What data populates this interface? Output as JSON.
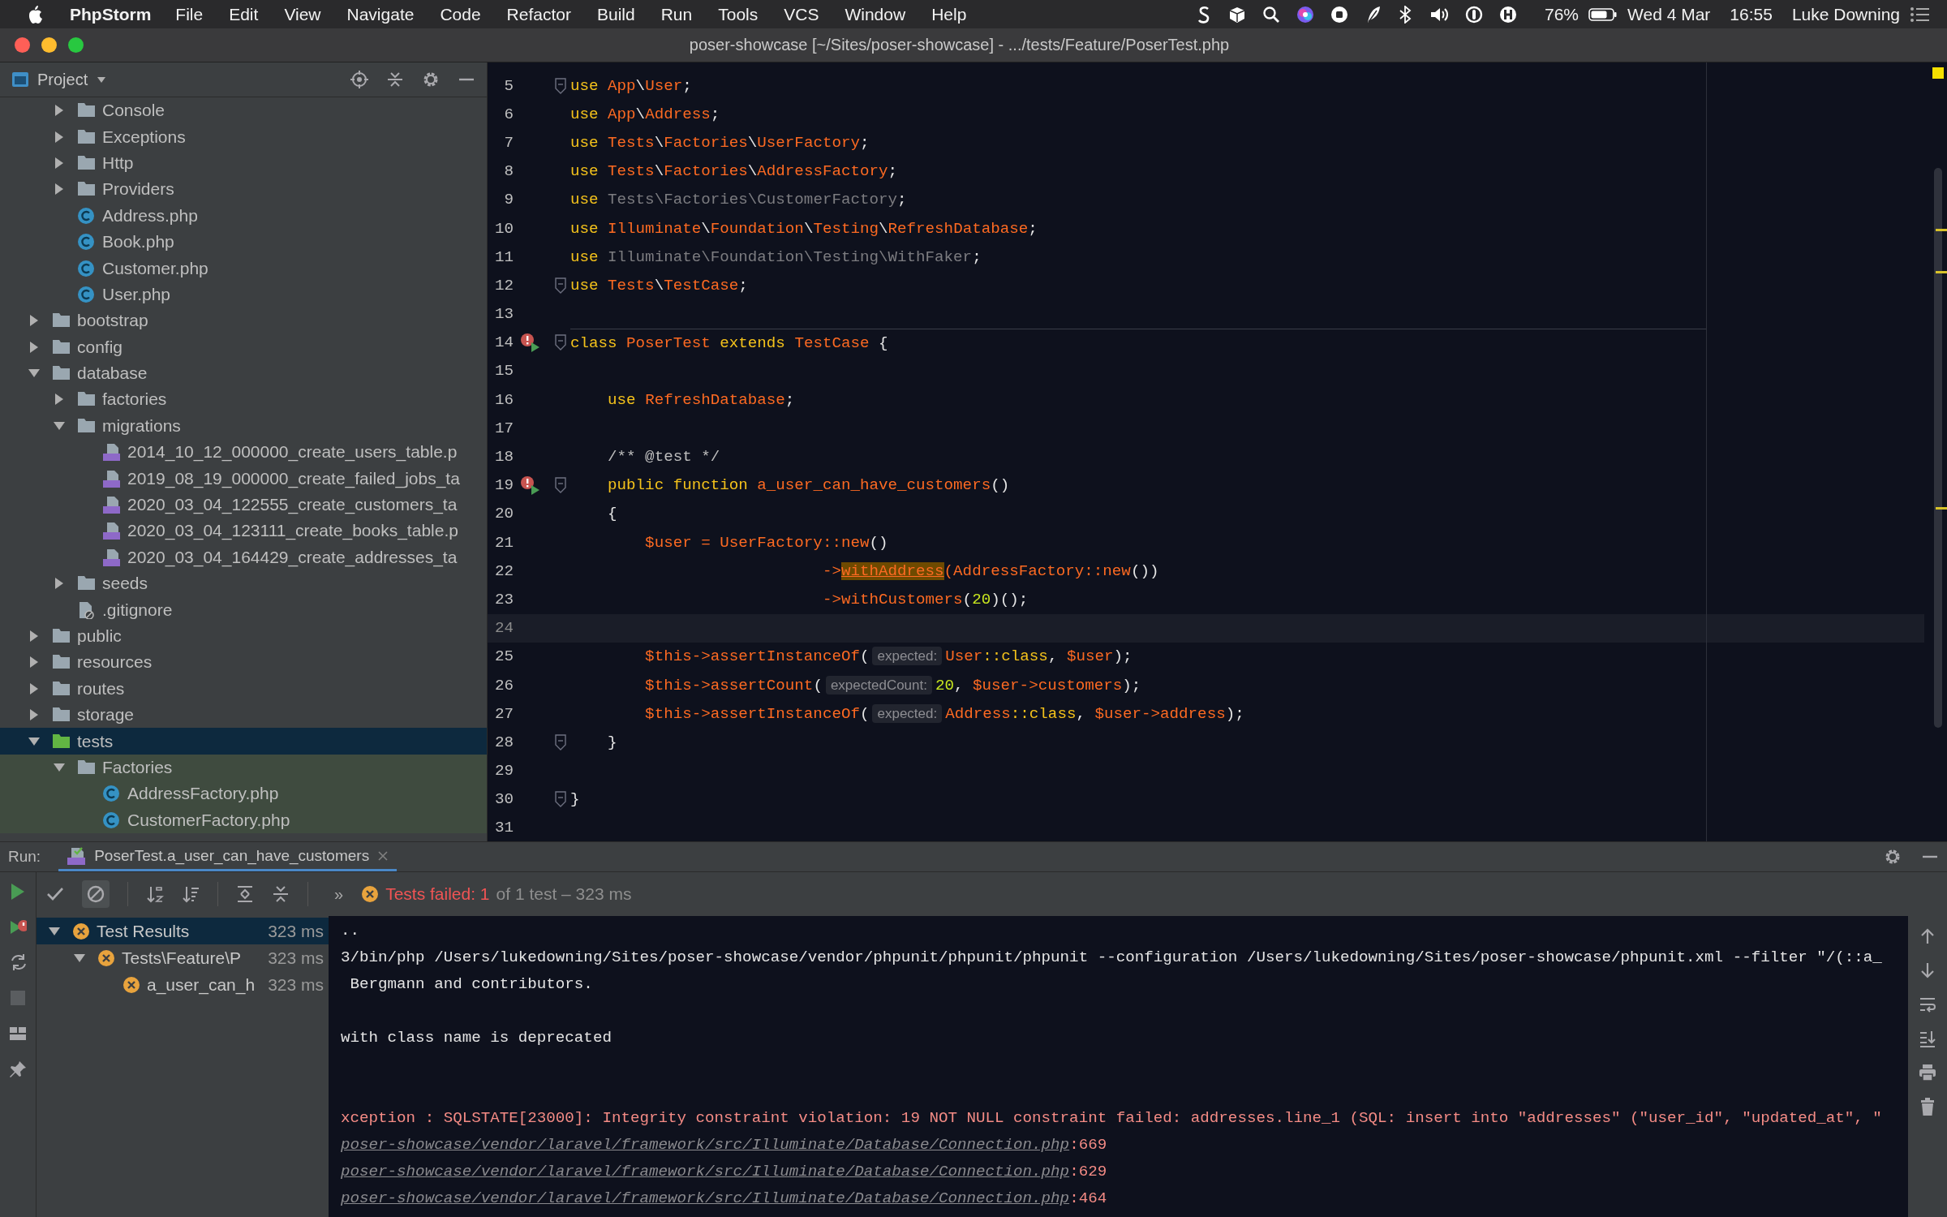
{
  "menu_bar": {
    "app": "PhpStorm",
    "menus": [
      "File",
      "Edit",
      "View",
      "Navigate",
      "Code",
      "Refactor",
      "Build",
      "Run",
      "Tools",
      "VCS",
      "Window",
      "Help"
    ],
    "battery": "76%",
    "date": "Wed 4 Mar",
    "time": "16:55",
    "user": "Luke Downing"
  },
  "window": {
    "title": "poser-showcase [~/Sites/poser-showcase] - .../tests/Feature/PoserTest.php"
  },
  "project_panel": {
    "title": "Project",
    "tree": {
      "continued": [
        {
          "label": "Console",
          "kind": "folder",
          "expanded": false,
          "selected": false
        },
        {
          "label": "Exceptions",
          "kind": "folder",
          "expanded": false,
          "selected": false
        },
        {
          "label": "Http",
          "kind": "folder",
          "expanded": false,
          "selected": false
        },
        {
          "label": "Providers",
          "kind": "folder",
          "expanded": false,
          "selected": false
        },
        {
          "label": "Address.php",
          "kind": "class",
          "selected": false
        },
        {
          "label": "Book.php",
          "kind": "class",
          "selected": false
        },
        {
          "label": "Customer.php",
          "kind": "class",
          "selected": false
        },
        {
          "label": "User.php",
          "kind": "class",
          "selected": false
        }
      ],
      "items": [
        {
          "label": "bootstrap",
          "kind": "folder",
          "expanded": false,
          "selected": false
        },
        {
          "label": "config",
          "kind": "folder",
          "expanded": false,
          "selected": false
        },
        {
          "label": "database",
          "kind": "folder",
          "expanded": true,
          "selected": false,
          "children": [
            {
              "label": "factories",
              "kind": "folder",
              "expanded": false,
              "selected": false
            },
            {
              "label": "migrations",
              "kind": "folder",
              "expanded": true,
              "selected": false,
              "children": [
                {
                  "label": "2014_10_12_000000_create_users_table.p",
                  "kind": "php",
                  "selected": false
                },
                {
                  "label": "2019_08_19_000000_create_failed_jobs_ta",
                  "kind": "php",
                  "selected": false
                },
                {
                  "label": "2020_03_04_122555_create_customers_ta",
                  "kind": "php",
                  "selected": false
                },
                {
                  "label": "2020_03_04_123111_create_books_table.p",
                  "kind": "php",
                  "selected": false
                },
                {
                  "label": "2020_03_04_164429_create_addresses_ta",
                  "kind": "php",
                  "selected": false
                }
              ]
            },
            {
              "label": "seeds",
              "kind": "folder",
              "expanded": false,
              "selected": false
            },
            {
              "label": ".gitignore",
              "kind": "ignore",
              "selected": false
            }
          ]
        },
        {
          "label": "public",
          "kind": "folder",
          "expanded": false,
          "selected": false
        },
        {
          "label": "resources",
          "kind": "folder",
          "expanded": false,
          "selected": false
        },
        {
          "label": "routes",
          "kind": "folder",
          "expanded": false,
          "selected": false
        },
        {
          "label": "storage",
          "kind": "folder",
          "expanded": false,
          "selected": false
        },
        {
          "label": "tests",
          "kind": "test-folder",
          "expanded": true,
          "selected": true,
          "children": [
            {
              "label": "Factories",
              "kind": "folder",
              "expanded": true,
              "selected": false,
              "children": [
                {
                  "label": "AddressFactory.php",
                  "kind": "class",
                  "selected": false
                },
                {
                  "label": "CustomerFactory.php",
                  "kind": "class",
                  "selected": false
                }
              ]
            }
          ]
        }
      ]
    }
  },
  "editor": {
    "lines": [
      {
        "number": "5",
        "fold": true,
        "marker": false,
        "current": false,
        "separator": false,
        "tokens": [
          {
            "kind": "keyword",
            "text": "use "
          },
          {
            "kind": "name",
            "text": "App"
          },
          {
            "kind": "plain",
            "text": "\\"
          },
          {
            "kind": "name",
            "text": "User"
          },
          {
            "kind": "plain",
            "text": ";"
          }
        ]
      },
      {
        "number": "6",
        "fold": false,
        "marker": false,
        "current": false,
        "separator": false,
        "tokens": [
          {
            "kind": "keyword",
            "text": "use "
          },
          {
            "kind": "name",
            "text": "App"
          },
          {
            "kind": "plain",
            "text": "\\"
          },
          {
            "kind": "name",
            "text": "Address"
          },
          {
            "kind": "plain",
            "text": ";"
          }
        ]
      },
      {
        "number": "7",
        "fold": false,
        "marker": false,
        "current": false,
        "separator": false,
        "tokens": [
          {
            "kind": "keyword",
            "text": "use "
          },
          {
            "kind": "name",
            "text": "Tests"
          },
          {
            "kind": "plain",
            "text": "\\"
          },
          {
            "kind": "name",
            "text": "Factories"
          },
          {
            "kind": "plain",
            "text": "\\"
          },
          {
            "kind": "name",
            "text": "UserFactory"
          },
          {
            "kind": "plain",
            "text": ";"
          }
        ]
      },
      {
        "number": "8",
        "fold": false,
        "marker": false,
        "current": false,
        "separator": false,
        "tokens": [
          {
            "kind": "keyword",
            "text": "use "
          },
          {
            "kind": "name",
            "text": "Tests"
          },
          {
            "kind": "plain",
            "text": "\\"
          },
          {
            "kind": "name",
            "text": "Factories"
          },
          {
            "kind": "plain",
            "text": "\\"
          },
          {
            "kind": "name",
            "text": "AddressFactory"
          },
          {
            "kind": "plain",
            "text": ";"
          }
        ]
      },
      {
        "number": "9",
        "fold": false,
        "marker": false,
        "current": false,
        "separator": false,
        "tokens": [
          {
            "kind": "keyword",
            "text": "use "
          },
          {
            "kind": "dim",
            "text": "Tests\\Factories\\CustomerFactory"
          },
          {
            "kind": "plain",
            "text": ";"
          }
        ]
      },
      {
        "number": "10",
        "fold": false,
        "marker": false,
        "current": false,
        "separator": false,
        "tokens": [
          {
            "kind": "keyword",
            "text": "use "
          },
          {
            "kind": "name",
            "text": "Illuminate"
          },
          {
            "kind": "plain",
            "text": "\\"
          },
          {
            "kind": "name",
            "text": "Foundation"
          },
          {
            "kind": "plain",
            "text": "\\"
          },
          {
            "kind": "name",
            "text": "Testing"
          },
          {
            "kind": "plain",
            "text": "\\"
          },
          {
            "kind": "name",
            "text": "RefreshDatabase"
          },
          {
            "kind": "plain",
            "text": ";"
          }
        ]
      },
      {
        "number": "11",
        "fold": false,
        "marker": false,
        "current": false,
        "separator": false,
        "tokens": [
          {
            "kind": "keyword",
            "text": "use "
          },
          {
            "kind": "dim",
            "text": "Illuminate\\Foundation\\Testing\\WithFaker"
          },
          {
            "kind": "plain",
            "text": ";"
          }
        ]
      },
      {
        "number": "12",
        "fold": true,
        "marker": false,
        "current": false,
        "separator": false,
        "tokens": [
          {
            "kind": "keyword",
            "text": "use "
          },
          {
            "kind": "name",
            "text": "Tests"
          },
          {
            "kind": "plain",
            "text": "\\"
          },
          {
            "kind": "name",
            "text": "TestCase"
          },
          {
            "kind": "plain",
            "text": ";"
          }
        ]
      },
      {
        "number": "13",
        "fold": false,
        "marker": false,
        "current": false,
        "separator": false
      },
      {
        "number": "14",
        "fold": true,
        "marker": true,
        "current": false,
        "separator": true,
        "tokens": [
          {
            "kind": "keyword",
            "text": "class "
          },
          {
            "kind": "name",
            "text": "PoserTest"
          },
          {
            "kind": "keyword",
            "text": " extends "
          },
          {
            "kind": "name",
            "text": "TestCase"
          },
          {
            "kind": "plain",
            "text": " {"
          }
        ]
      },
      {
        "number": "15",
        "fold": false,
        "marker": false,
        "current": false,
        "separator": false
      },
      {
        "number": "16",
        "fold": false,
        "marker": false,
        "current": false,
        "separator": false,
        "tokens": [
          {
            "kind": "keyword",
            "text": "    use "
          },
          {
            "kind": "name",
            "text": "RefreshDatabase"
          },
          {
            "kind": "plain",
            "text": ";"
          }
        ]
      },
      {
        "number": "17",
        "fold": false,
        "marker": false,
        "current": false,
        "separator": false
      },
      {
        "number": "18",
        "fold": false,
        "marker": false,
        "current": false,
        "separator": false,
        "tokens": [
          {
            "kind": "comment",
            "text": "    /** @test */"
          }
        ]
      },
      {
        "number": "19",
        "fold": true,
        "marker": true,
        "current": false,
        "separator": false,
        "tokens": [
          {
            "kind": "keyword",
            "text": "    public function "
          },
          {
            "kind": "name",
            "text": "a_user_can_have_customers"
          },
          {
            "kind": "plain",
            "text": "()"
          }
        ]
      },
      {
        "number": "20",
        "fold": false,
        "marker": false,
        "current": false,
        "separator": false,
        "tokens": [
          {
            "kind": "plain",
            "text": "    {"
          }
        ]
      },
      {
        "number": "21",
        "fold": false,
        "marker": false,
        "current": false,
        "separator": false,
        "tokens": [
          {
            "kind": "name",
            "text": "        $user = UserFactory::new"
          },
          {
            "kind": "plain",
            "text": "()"
          }
        ]
      },
      {
        "number": "22",
        "fold": false,
        "marker": false,
        "current": false,
        "separator": false,
        "tokens": [
          {
            "kind": "name",
            "text": "                           ->"
          },
          {
            "kind": "highlight",
            "text": "withAddress"
          },
          {
            "kind": "name",
            "text": "(AddressFactory::new"
          },
          {
            "kind": "plain",
            "text": "())"
          }
        ]
      },
      {
        "number": "23",
        "fold": false,
        "marker": false,
        "current": false,
        "separator": false,
        "tokens": [
          {
            "kind": "name",
            "text": "                           ->withCustomers"
          },
          {
            "kind": "plain",
            "text": "("
          },
          {
            "kind": "number",
            "text": "20"
          },
          {
            "kind": "plain",
            "text": ")();"
          }
        ]
      },
      {
        "number": "24",
        "fold": false,
        "marker": false,
        "current": true,
        "separator": false
      },
      {
        "number": "25",
        "fold": false,
        "marker": false,
        "current": false,
        "separator": false,
        "tokens": [
          {
            "kind": "name",
            "text": "        $this->assertInstanceOf"
          },
          {
            "kind": "plain",
            "text": "("
          },
          {
            "kind": "hint",
            "text": "expected:"
          },
          {
            "kind": "name",
            "text": "User"
          },
          {
            "kind": "keyword",
            "text": "::class"
          },
          {
            "kind": "plain",
            "text": ", "
          },
          {
            "kind": "name",
            "text": "$user"
          },
          {
            "kind": "plain",
            "text": ");"
          }
        ]
      },
      {
        "number": "26",
        "fold": false,
        "marker": false,
        "current": false,
        "separator": false,
        "tokens": [
          {
            "kind": "name",
            "text": "        $this->assertCount"
          },
          {
            "kind": "plain",
            "text": "("
          },
          {
            "kind": "hint",
            "text": "expectedCount:"
          },
          {
            "kind": "number",
            "text": "20"
          },
          {
            "kind": "plain",
            "text": ", "
          },
          {
            "kind": "name",
            "text": "$user->customers"
          },
          {
            "kind": "plain",
            "text": ");"
          }
        ]
      },
      {
        "number": "27",
        "fold": false,
        "marker": false,
        "current": false,
        "separator": false,
        "tokens": [
          {
            "kind": "name",
            "text": "        $this->assertInstanceOf"
          },
          {
            "kind": "plain",
            "text": "("
          },
          {
            "kind": "hint",
            "text": "expected:"
          },
          {
            "kind": "name",
            "text": "Address"
          },
          {
            "kind": "keyword",
            "text": "::class"
          },
          {
            "kind": "plain",
            "text": ", "
          },
          {
            "kind": "name",
            "text": "$user->address"
          },
          {
            "kind": "plain",
            "text": ");"
          }
        ]
      },
      {
        "number": "28",
        "fold": true,
        "marker": false,
        "current": false,
        "separator": false,
        "tokens": [
          {
            "kind": "plain",
            "text": "    }"
          }
        ]
      },
      {
        "number": "29",
        "fold": false,
        "marker": false,
        "current": false,
        "separator": false
      },
      {
        "number": "30",
        "fold": true,
        "marker": false,
        "current": false,
        "separator": false,
        "tokens": [
          {
            "kind": "plain",
            "text": "}"
          }
        ]
      },
      {
        "number": "31",
        "fold": false,
        "marker": false,
        "current": false,
        "separator": false
      }
    ]
  },
  "run_panel": {
    "label": "Run:",
    "tab": "PoserTest.a_user_can_have_customers",
    "more": "»",
    "status_label": "Tests failed: 1",
    "status_detail": "of 1 test – 323 ms",
    "results": [
      {
        "label": "Test Results",
        "time": "323 ms",
        "kind": "failed",
        "expanded": true,
        "selected": true,
        "children": [
          {
            "label": "Tests\\Feature\\P",
            "time": "323 ms",
            "kind": "failed",
            "expanded": true,
            "selected": false,
            "children": [
              {
                "label": "a_user_can_h",
                "time": "323 ms",
                "kind": "failed",
                "selected": false
              }
            ]
          }
        ]
      }
    ],
    "console": [
      {
        "kind": "plain",
        "text": ".."
      },
      {
        "kind": "plain",
        "text": "3/bin/php /Users/lukedowning/Sites/poser-showcase/vendor/phpunit/phpunit/phpunit --configuration /Users/lukedowning/Sites/poser-showcase/phpunit.xml --filter \"/(::a_"
      },
      {
        "kind": "plain",
        "text": " Bergmann and contributors."
      },
      {
        "kind": "blank"
      },
      {
        "kind": "plain",
        "text": "with class name is deprecated"
      },
      {
        "kind": "blank"
      },
      {
        "kind": "blank"
      },
      {
        "kind": "error",
        "text": "xception : SQLSTATE[23000]: Integrity constraint violation: 19 NOT NULL constraint failed: addresses.line_1 (SQL: insert into \"addresses\" (\"user_id\", \"updated_at\", \""
      },
      {
        "kind": "trace",
        "link": "poser-showcase/vendor/laravel/framework/src/Illuminate/Database/Connection.php",
        "text": ":669"
      },
      {
        "kind": "trace",
        "link": "poser-showcase/vendor/laravel/framework/src/Illuminate/Database/Connection.php",
        "text": ":629"
      },
      {
        "kind": "trace",
        "link": "poser-showcase/vendor/laravel/framework/src/Illuminate/Database/Connection.php",
        "text": ":464"
      }
    ]
  }
}
